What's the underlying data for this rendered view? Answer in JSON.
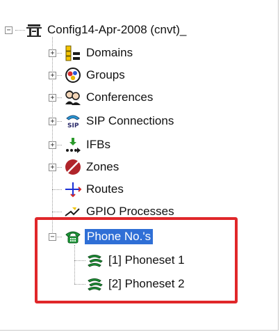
{
  "tree": {
    "root": {
      "label": "Config14-Apr-2008 (cnvt)_",
      "icon": "config-root-icon"
    },
    "items": [
      {
        "label": "Domains",
        "icon": "domains-icon",
        "expander": "+"
      },
      {
        "label": "Groups",
        "icon": "groups-icon",
        "expander": "+"
      },
      {
        "label": "Conferences",
        "icon": "conferences-icon",
        "expander": "+"
      },
      {
        "label": "SIP Connections",
        "icon": "sip-connections-icon",
        "expander": "+"
      },
      {
        "label": "IFBs",
        "icon": "ifbs-icon",
        "expander": "+"
      },
      {
        "label": "Zones",
        "icon": "zones-icon",
        "expander": "+"
      },
      {
        "label": "Routes",
        "icon": "routes-icon"
      },
      {
        "label": "GPIO Processes",
        "icon": "gpio-processes-icon"
      },
      {
        "label": "Phone No.'s",
        "icon": "phone-icon",
        "expander": "−",
        "selected": true,
        "children": [
          {
            "label": "[1] Phoneset 1",
            "icon": "phoneset-icon"
          },
          {
            "label": "[2] Phoneset 2",
            "icon": "phoneset-icon"
          }
        ]
      }
    ],
    "root_expander": "−",
    "sip_text": "SIP"
  },
  "colors": {
    "selection": "#2f6fd6",
    "highlight_border": "#e0272a",
    "phone_green": "#1f9a3a"
  }
}
